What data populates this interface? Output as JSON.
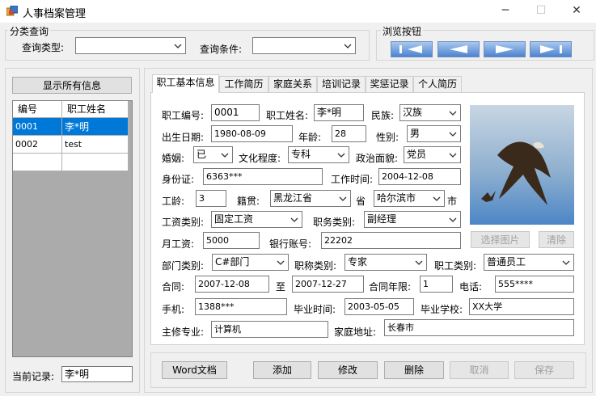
{
  "window": {
    "title": "人事档案管理",
    "min_glyph": "─",
    "max_glyph": "☐",
    "close_glyph": "✕"
  },
  "query_group": {
    "title": "分类查询",
    "type_label": "查询类型:",
    "type_value": "",
    "cond_label": "查询条件:",
    "cond_value": ""
  },
  "browse_group": {
    "title": "浏览按钮"
  },
  "left_panel": {
    "show_all_label": "显示所有信息",
    "columns": [
      "编号",
      "职工姓名"
    ],
    "rows": [
      {
        "id": "0001",
        "name": "李*明",
        "selected": true
      },
      {
        "id": "0002",
        "name": "test",
        "selected": false
      }
    ],
    "current_label": "当前记录:",
    "current_value": "李*明"
  },
  "tabs": [
    "职工基本信息",
    "工作简历",
    "家庭关系",
    "培训记录",
    "奖惩记录",
    "个人简历"
  ],
  "form": {
    "emp_no_label": "职工编号:",
    "emp_no": "0001",
    "emp_name_label": "职工姓名:",
    "emp_name": "李*明",
    "ethnic_label": "民族:",
    "ethnic": "汉族",
    "birth_label": "出生日期:",
    "birth": "1980-08-09",
    "age_label": "年龄:",
    "age": "28",
    "gender_label": "性别:",
    "gender": "男",
    "marriage_label": "婚姻:",
    "marriage": "已",
    "education_label": "文化程度:",
    "education": "专科",
    "politics_label": "政治面貌:",
    "politics": "党员",
    "id_label": "身份证:",
    "id_no": "6363***",
    "work_time_label": "工作时间:",
    "work_time": "2004-12-08",
    "seniority_label": "工龄:",
    "seniority": "3",
    "native_label": "籍贯:",
    "province": "黑龙江省",
    "province_suffix": "省",
    "city": "哈尔滨市",
    "city_suffix": "市",
    "salary_type_label": "工资类别:",
    "salary_type": "固定工资",
    "title_type_label": "职务类别:",
    "title_type": "副经理",
    "monthly_salary_label": "月工资:",
    "monthly_salary": "5000",
    "bank_label": "银行账号:",
    "bank": "22202",
    "dept_label": "部门类别:",
    "dept": "C#部门",
    "rank_label": "职称类别:",
    "rank": "专家",
    "worker_type_label": "职工类别:",
    "worker_type": "普通员工",
    "contract_label": "合同:",
    "contract_start": "2007-12-08",
    "to_label": "至",
    "contract_end": "2007-12-27",
    "contract_years_label": "合同年限:",
    "contract_years": "1",
    "phone_label": "电话:",
    "phone": "555****",
    "mobile_label": "手机:",
    "mobile": "1388***",
    "grad_time_label": "毕业时间:",
    "grad_time": "2003-05-05",
    "school_label": "毕业学校:",
    "school": "XX大学",
    "major_label": "主修专业:",
    "major": "计算机",
    "address_label": "家庭地址:",
    "address": "长春市",
    "choose_photo_label": "选择图片",
    "clear_photo_label": "清除"
  },
  "actions": {
    "word_label": "Word文档",
    "add_label": "添加",
    "edit_label": "修改",
    "delete_label": "删除",
    "cancel_label": "取消",
    "save_label": "保存"
  },
  "colors": {
    "selected_row": "#0078d7",
    "grid_bg": "#ababab",
    "nav_blue": "#4d84d0"
  }
}
